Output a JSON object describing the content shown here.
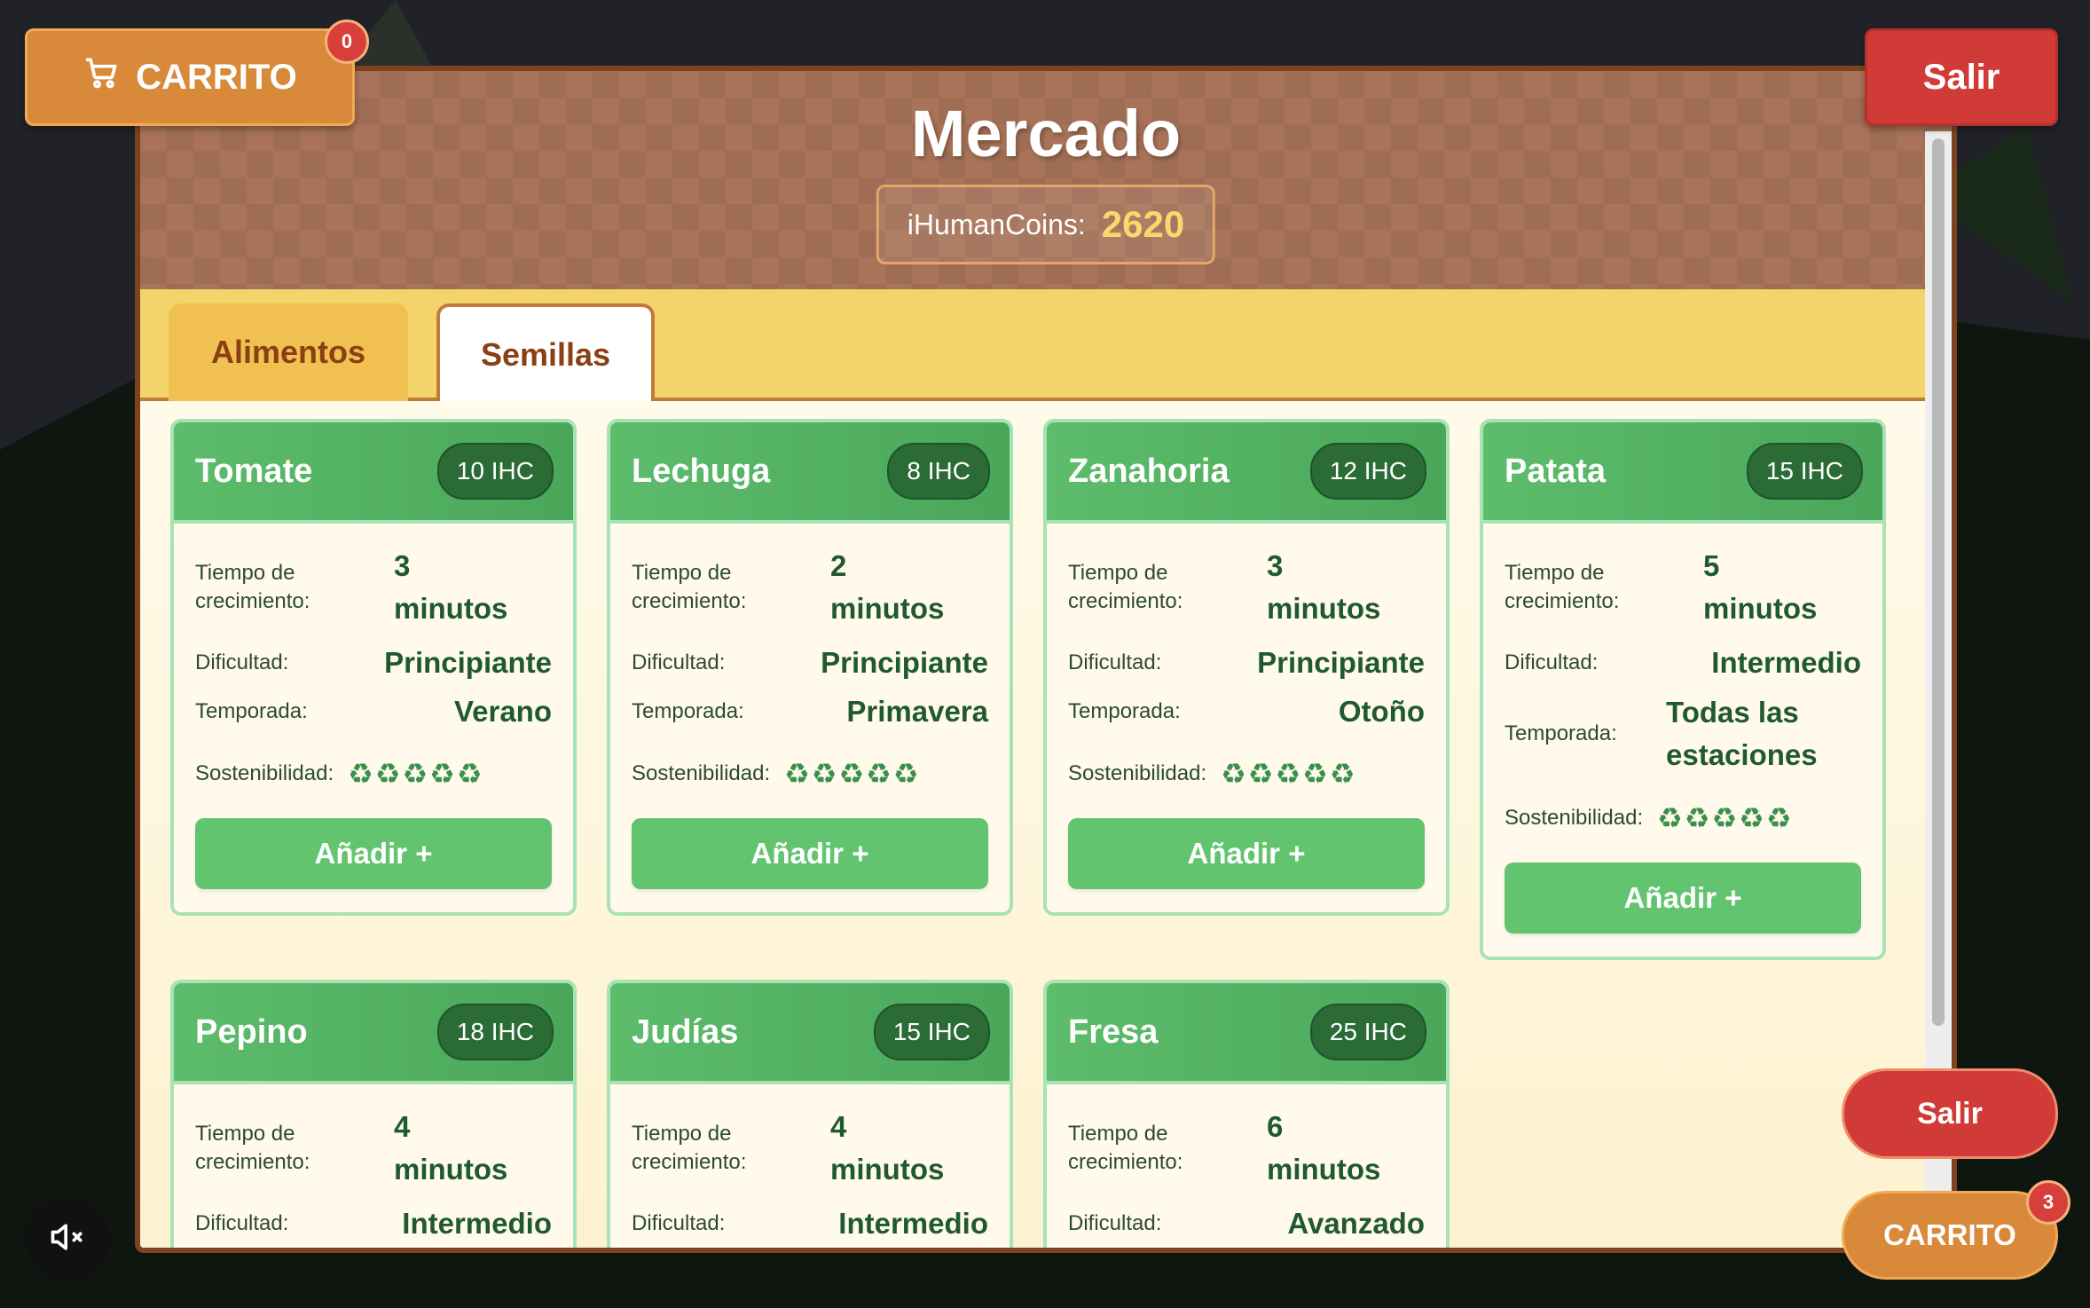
{
  "header": {
    "title": "Mercado",
    "coins_label": "iHumanCoins:",
    "coins_value": "2620"
  },
  "cart_top": {
    "label": "CARRITO",
    "count": "0",
    "icon": "cart-icon"
  },
  "exit_top": {
    "label": "Salir"
  },
  "exit_bottom": {
    "label": "Salir"
  },
  "cart_bottom": {
    "label": "CARRITO",
    "count": "3"
  },
  "mute": {
    "icon": "speaker-muted-icon"
  },
  "tabs": [
    {
      "label": "Alimentos",
      "active": false
    },
    {
      "label": "Semillas",
      "active": true
    }
  ],
  "labels": {
    "growth": "Tiempo de crecimiento:",
    "difficulty": "Dificultad:",
    "season": "Temporada:",
    "sustainability": "Sostenibilidad:",
    "add": "Añadir +"
  },
  "sustainability_icons": "♻♻♻♻♻",
  "seeds": [
    {
      "name": "Tomate",
      "price": "10 IHC",
      "growth_n": "3",
      "growth_u": "minutos",
      "difficulty": "Principiante",
      "season": "Verano"
    },
    {
      "name": "Lechuga",
      "price": "8 IHC",
      "growth_n": "2",
      "growth_u": "minutos",
      "difficulty": "Principiante",
      "season": "Primavera"
    },
    {
      "name": "Zanahoria",
      "price": "12 IHC",
      "growth_n": "3",
      "growth_u": "minutos",
      "difficulty": "Principiante",
      "season": "Otoño"
    },
    {
      "name": "Patata",
      "price": "15 IHC",
      "growth_n": "5",
      "growth_u": "minutos",
      "difficulty": "Intermedio",
      "season": "Todas las estaciones"
    },
    {
      "name": "Pepino",
      "price": "18 IHC",
      "growth_n": "4",
      "growth_u": "minutos",
      "difficulty": "Intermedio"
    },
    {
      "name": "Judías",
      "price": "15 IHC",
      "growth_n": "4",
      "growth_u": "minutos",
      "difficulty": "Intermedio"
    },
    {
      "name": "Fresa",
      "price": "25 IHC",
      "growth_n": "6",
      "growth_u": "minutos",
      "difficulty": "Avanzado"
    }
  ],
  "colors": {
    "accent_green": "#63c46f",
    "header_green": "#4aa659",
    "cart_orange": "#d8893a",
    "exit_red": "#d13b37",
    "coins_gold": "#ffd66b"
  }
}
